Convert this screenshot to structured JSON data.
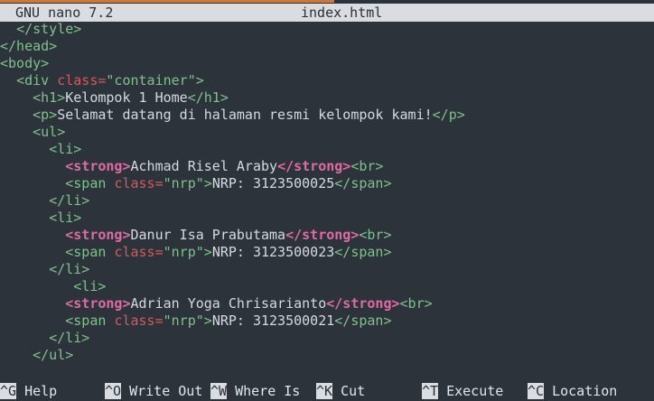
{
  "titlebar": {
    "app": "GNU nano 7.2",
    "filename": "index.html"
  },
  "lines": [
    [
      {
        "t": "  "
      },
      {
        "t": "</style>",
        "c": "tag"
      }
    ],
    [
      {
        "t": "</head>",
        "c": "tag"
      }
    ],
    [
      {
        "t": "<body>",
        "c": "tag"
      }
    ],
    [
      {
        "t": "  "
      },
      {
        "t": "<div ",
        "c": "tag"
      },
      {
        "t": "class=",
        "c": "attr"
      },
      {
        "t": "\"container\"",
        "c": "str"
      },
      {
        "t": ">",
        "c": "tag"
      }
    ],
    [
      {
        "t": "    "
      },
      {
        "t": "<h1>",
        "c": "tag"
      },
      {
        "t": "Kelompok 1 Home",
        "c": "txt"
      },
      {
        "t": "</h1>",
        "c": "tag"
      }
    ],
    [
      {
        "t": "    "
      },
      {
        "t": "<p>",
        "c": "tag"
      },
      {
        "t": "Selamat datang di halaman resmi kelompok kami!",
        "c": "txt"
      },
      {
        "t": "</p>",
        "c": "tag"
      }
    ],
    [
      {
        "t": "    "
      },
      {
        "t": "<ul>",
        "c": "tag"
      }
    ],
    [
      {
        "t": "      "
      },
      {
        "t": "<li>",
        "c": "tag"
      }
    ],
    [
      {
        "t": "        "
      },
      {
        "t": "<strong>",
        "c": "strong-tag"
      },
      {
        "t": "Achmad Risel Araby",
        "c": "txt"
      },
      {
        "t": "</strong>",
        "c": "strong-tag"
      },
      {
        "t": "<br>",
        "c": "tag"
      }
    ],
    [
      {
        "t": "        "
      },
      {
        "t": "<span ",
        "c": "tag"
      },
      {
        "t": "class=",
        "c": "attr"
      },
      {
        "t": "\"nrp\"",
        "c": "str"
      },
      {
        "t": ">",
        "c": "tag"
      },
      {
        "t": "NRP: 3123500025",
        "c": "txt"
      },
      {
        "t": "</span>",
        "c": "tag"
      }
    ],
    [
      {
        "t": "      "
      },
      {
        "t": "</li>",
        "c": "tag"
      }
    ],
    [
      {
        "t": "      "
      },
      {
        "t": "<li>",
        "c": "tag"
      }
    ],
    [
      {
        "t": "        "
      },
      {
        "t": "<strong>",
        "c": "strong-tag"
      },
      {
        "t": "Danur Isa Prabutama",
        "c": "txt"
      },
      {
        "t": "</strong>",
        "c": "strong-tag"
      },
      {
        "t": "<br>",
        "c": "tag"
      }
    ],
    [
      {
        "t": "        "
      },
      {
        "t": "<span ",
        "c": "tag"
      },
      {
        "t": "class=",
        "c": "attr"
      },
      {
        "t": "\"nrp\"",
        "c": "str"
      },
      {
        "t": ">",
        "c": "tag"
      },
      {
        "t": "NRP: 3123500023",
        "c": "txt"
      },
      {
        "t": "</span>",
        "c": "tag"
      }
    ],
    [
      {
        "t": "      "
      },
      {
        "t": "</li>",
        "c": "tag"
      }
    ],
    [
      {
        "t": "         "
      },
      {
        "t": "<li>",
        "c": "tag"
      }
    ],
    [
      {
        "t": "        "
      },
      {
        "t": "<strong>",
        "c": "strong-tag"
      },
      {
        "t": "Adrian Yoga Chrisarianto",
        "c": "txt"
      },
      {
        "t": "</strong>",
        "c": "strong-tag"
      },
      {
        "t": "<br>",
        "c": "tag"
      }
    ],
    [
      {
        "t": "        "
      },
      {
        "t": "<span ",
        "c": "tag"
      },
      {
        "t": "class=",
        "c": "attr"
      },
      {
        "t": "\"nrp\"",
        "c": "str"
      },
      {
        "t": ">",
        "c": "tag"
      },
      {
        "t": "NRP: 3123500021",
        "c": "txt"
      },
      {
        "t": "</span>",
        "c": "tag"
      }
    ],
    [
      {
        "t": "      "
      },
      {
        "t": "</li>",
        "c": "tag"
      }
    ],
    [
      {
        "t": "    "
      },
      {
        "t": "</ul>",
        "c": "tag"
      }
    ]
  ],
  "shortcuts": [
    {
      "key": "^G",
      "label": " Help"
    },
    {
      "key": "^O",
      "label": " Write Out"
    },
    {
      "key": "^W",
      "label": " Where Is"
    },
    {
      "key": "^K",
      "label": " Cut"
    },
    {
      "key": "^T",
      "label": " Execute"
    },
    {
      "key": "^C",
      "label": " Location"
    }
  ]
}
